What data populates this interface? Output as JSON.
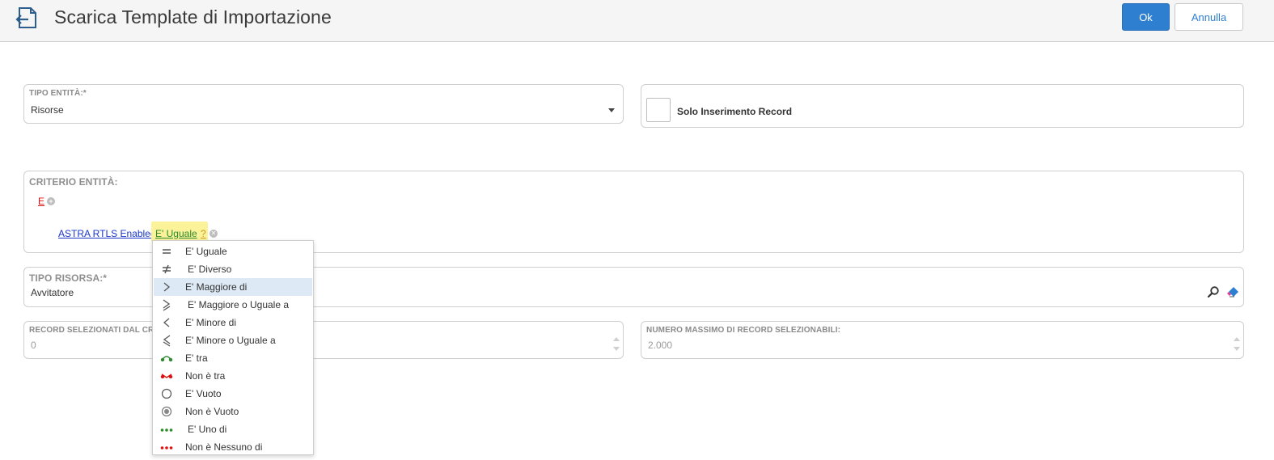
{
  "header": {
    "title": "Scarica Template di Importazione",
    "ok_label": "Ok",
    "cancel_label": "Annulla"
  },
  "tipo_entita": {
    "label": "TIPO ENTITÀ:*",
    "value": "Risorse"
  },
  "solo_inserimento": {
    "label": "Solo Inserimento Record",
    "checked": false
  },
  "criterio": {
    "label": "CRITERIO ENTITÀ:",
    "logic": "E",
    "attribute": "ASTRA RTLS Enabled?",
    "operator": "E' Uguale",
    "value": "?"
  },
  "tipo_risorsa": {
    "label": "TIPO RISORSA:*",
    "value": "Avvitatore"
  },
  "record_selezionati": {
    "label": "RECORD SELEZIONATI DAL CRITE",
    "value": "0"
  },
  "numero_massimo": {
    "label": "NUMERO MASSIMO DI RECORD SELEZIONABILI:",
    "value": "2.000"
  },
  "operators": [
    {
      "label": "E' Uguale",
      "icon": "equals-icon"
    },
    {
      "label": "E' Diverso",
      "icon": "not-equals-icon"
    },
    {
      "label": "E' Maggiore di",
      "icon": "greater-than-icon"
    },
    {
      "label": "E' Maggiore o Uguale a",
      "icon": "greater-equal-icon"
    },
    {
      "label": "E' Minore di",
      "icon": "less-than-icon"
    },
    {
      "label": "E' Minore o Uguale a",
      "icon": "less-equal-icon"
    },
    {
      "label": "E' tra",
      "icon": "between-icon"
    },
    {
      "label": "Non è tra",
      "icon": "not-between-icon"
    },
    {
      "label": "E' Vuoto",
      "icon": "empty-circle-icon"
    },
    {
      "label": "Non è Vuoto",
      "icon": "filled-circle-icon"
    },
    {
      "label": "E' Uno di",
      "icon": "one-of-icon"
    },
    {
      "label": "Non è Nessuno di",
      "icon": "none-of-icon"
    }
  ],
  "selected_operator_index": 2,
  "colors": {
    "primary": "#2f7fd1",
    "link": "#1a36c9",
    "operator_highlight": "#fbf29a",
    "selected_row": "#dde9f5",
    "green": "#2e8b2e",
    "red": "#d11"
  }
}
